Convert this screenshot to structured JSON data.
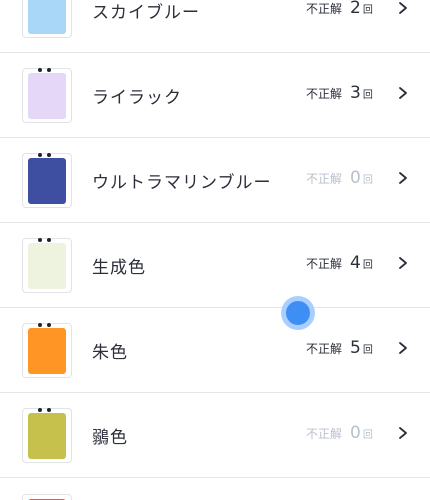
{
  "items": [
    {
      "name": "スカイブルー",
      "label": "不正解",
      "count": "2",
      "unit": "回",
      "color": "#a9d7f7",
      "zero": false
    },
    {
      "name": "ライラック",
      "label": "不正解",
      "count": "3",
      "unit": "回",
      "color": "#e4d7f8",
      "zero": false
    },
    {
      "name": "ウルトラマリンブルー",
      "label": "不正解",
      "count": "0",
      "unit": "回",
      "color": "#3e4fa2",
      "zero": true
    },
    {
      "name": "生成色",
      "label": "不正解",
      "count": "4",
      "unit": "回",
      "color": "#eef3df",
      "zero": false
    },
    {
      "name": "朱色",
      "label": "不正解",
      "count": "5",
      "unit": "回",
      "color": "#ff9524",
      "zero": false
    },
    {
      "name": "鶸色",
      "label": "不正解",
      "count": "0",
      "unit": "回",
      "color": "#c6c04c",
      "zero": true
    }
  ],
  "partial_color": "#e85a2a",
  "touch_color": "#3f8ef5"
}
